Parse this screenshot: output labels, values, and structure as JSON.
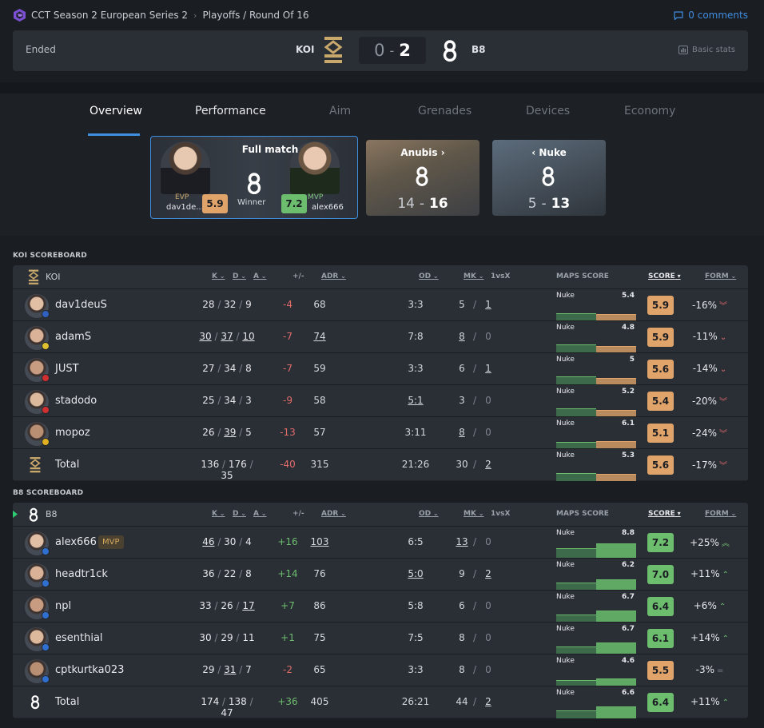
{
  "breadcrumb": {
    "event": "CCT Season 2 European Series 2",
    "stage": "Playoffs / Round Of 16"
  },
  "comments": "0 comments",
  "match": {
    "status": "Ended",
    "team1": "KOI",
    "team2": "B8",
    "score1": "0",
    "score2": "2",
    "basic_stats": "Basic stats"
  },
  "tabs": [
    "Overview",
    "Performance",
    "Aim",
    "Grenades",
    "Devices",
    "Economy"
  ],
  "active_tab": "Overview",
  "full_match": {
    "title": "Full match",
    "evp_label": "EVP",
    "evp_name": "dav1de...",
    "evp_rating": "5.9",
    "winner": "Winner",
    "mvp_label": "MVP",
    "mvp_name": "alex666",
    "mvp_rating": "7.2"
  },
  "maps": [
    {
      "title": "Anubis",
      "score_lose": "14",
      "score_win": "16",
      "arrow": "›"
    },
    {
      "title": "Nuke",
      "score_lose": "5",
      "score_win": "13",
      "arrow": "‹"
    }
  ],
  "columns": {
    "k": "K",
    "d": "D",
    "a": "A",
    "pm": "+/-",
    "adr": "ADR",
    "od": "OD",
    "mk": "MK",
    "clutch": "1vsX",
    "maps_score": "MAPS SCORE",
    "score": "SCORE",
    "form": "FORM"
  },
  "koi": {
    "title": "KOI SCOREBOARD",
    "team": "KOI",
    "players": [
      {
        "name": "dav1deuS",
        "k": "28",
        "d": "32",
        "a": "9",
        "pm": "-4",
        "adr": "68",
        "od": "3:3",
        "mk": "5",
        "clutch": "1",
        "map": "Nuke",
        "map_score": "5.4",
        "rating": "5.9",
        "form": "-16%"
      },
      {
        "name": "adamS",
        "k": "30",
        "d": "37",
        "a": "10",
        "pm": "-7",
        "adr": "74",
        "od": "7:8",
        "mk": "8",
        "clutch": "0",
        "map": "Nuke",
        "map_score": "4.8",
        "rating": "5.9",
        "form": "-11%"
      },
      {
        "name": "JUST",
        "k": "27",
        "d": "34",
        "a": "8",
        "pm": "-7",
        "adr": "59",
        "od": "3:3",
        "mk": "6",
        "clutch": "1",
        "map": "Nuke",
        "map_score": "5",
        "rating": "5.6",
        "form": "-14%"
      },
      {
        "name": "stadodo",
        "k": "25",
        "d": "34",
        "a": "3",
        "pm": "-9",
        "adr": "58",
        "od": "5:1",
        "mk": "3",
        "clutch": "0",
        "map": "Nuke",
        "map_score": "5.2",
        "rating": "5.4",
        "form": "-20%"
      },
      {
        "name": "mopoz",
        "k": "26",
        "d": "39",
        "a": "5",
        "pm": "-13",
        "adr": "57",
        "od": "3:11",
        "mk": "8",
        "clutch": "0",
        "map": "Nuke",
        "map_score": "6.1",
        "rating": "5.1",
        "form": "-24%"
      }
    ],
    "total": {
      "name": "Total",
      "k": "136",
      "d": "176",
      "a": "35",
      "pm": "-40",
      "adr": "315",
      "od": "21:26",
      "mk": "30",
      "clutch": "2",
      "map": "Nuke",
      "map_score": "5.3",
      "rating": "5.6",
      "form": "-17%"
    }
  },
  "b8": {
    "title": "B8 SCOREBOARD",
    "team": "B8",
    "players": [
      {
        "name": "alex666",
        "tag": "MVP",
        "k": "46",
        "d": "30",
        "a": "4",
        "pm": "+16",
        "adr": "103",
        "od": "6:5",
        "mk": "13",
        "clutch": "0",
        "map": "Nuke",
        "map_score": "8.8",
        "rating": "7.2",
        "form": "+25%"
      },
      {
        "name": "headtr1ck",
        "k": "36",
        "d": "22",
        "a": "8",
        "pm": "+14",
        "adr": "76",
        "od": "5:0",
        "mk": "9",
        "clutch": "2",
        "map": "Nuke",
        "map_score": "6.2",
        "rating": "7.0",
        "form": "+11%"
      },
      {
        "name": "npl",
        "k": "33",
        "d": "26",
        "a": "17",
        "pm": "+7",
        "adr": "86",
        "od": "5:8",
        "mk": "6",
        "clutch": "0",
        "map": "Nuke",
        "map_score": "6.7",
        "rating": "6.4",
        "form": "+6%"
      },
      {
        "name": "esenthial",
        "k": "30",
        "d": "29",
        "a": "11",
        "pm": "+1",
        "adr": "75",
        "od": "7:5",
        "mk": "8",
        "clutch": "0",
        "map": "Nuke",
        "map_score": "6.7",
        "rating": "6.1",
        "form": "+14%"
      },
      {
        "name": "cptkurtka023",
        "k": "29",
        "d": "31",
        "a": "7",
        "pm": "-2",
        "adr": "65",
        "od": "3:3",
        "mk": "8",
        "clutch": "0",
        "map": "Nuke",
        "map_score": "4.6",
        "rating": "5.5",
        "form": "-3%"
      }
    ],
    "total": {
      "name": "Total",
      "k": "174",
      "d": "138",
      "a": "47",
      "pm": "+36",
      "adr": "405",
      "od": "26:21",
      "mk": "44",
      "clutch": "2",
      "map": "Nuke",
      "map_score": "6.6",
      "rating": "6.4",
      "form": "+11%"
    }
  },
  "colors": {
    "accent": "#3f8ee0",
    "rating_bad": "#e0a36a",
    "rating_good": "#6dbd6e",
    "negative": "#e06b6b",
    "positive": "#6dbd6e"
  }
}
